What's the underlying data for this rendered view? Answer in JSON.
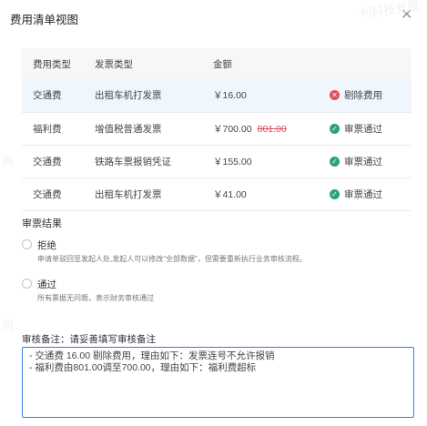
{
  "dialog": {
    "title": "费用清单视图",
    "close_icon": "close-icon"
  },
  "watermark": [
    "利科技有限",
    "司",
    "司"
  ],
  "table": {
    "headers": [
      "费用类型",
      "发票类型",
      "金额",
      ""
    ],
    "rows": [
      {
        "type": "交通费",
        "invoice": "出租车机打发票",
        "amount": "￥16.00",
        "old_amount": "",
        "status": "剔除费用",
        "status_icon": "close-circle-icon",
        "status_color": "#e34d59",
        "highlighted": true
      },
      {
        "type": "福利费",
        "invoice": "增值税普通发票",
        "amount": "￥700.00",
        "old_amount": "801.00",
        "status": "审票通过",
        "status_icon": "check-circle-icon",
        "status_color": "#2ba471",
        "highlighted": false
      },
      {
        "type": "交通费",
        "invoice": "铁路车票报销凭证",
        "amount": "￥155.00",
        "old_amount": "",
        "status": "审票通过",
        "status_icon": "check-circle-icon",
        "status_color": "#2ba471",
        "highlighted": false
      },
      {
        "type": "交通费",
        "invoice": "出租车机打发票",
        "amount": "￥41.00",
        "old_amount": "",
        "status": "审票通过",
        "status_icon": "check-circle-icon",
        "status_color": "#2ba471",
        "highlighted": false
      }
    ]
  },
  "review": {
    "label": "审票结果",
    "options": [
      {
        "label": "拒绝",
        "desc": "申请单驳回至发起人处,发起人可以修改\"全部数据\"，但需要重新执行业务审核流程。"
      },
      {
        "label": "通过",
        "desc": "所有票据无问题，表示财务审核通过"
      }
    ]
  },
  "note": {
    "label": "审核备注：请妥善填写审核备注",
    "value": "- 交通费 16.00 剔除费用，理由如下：发票连号不允许报销\n- 福利费由801.00调至700.00，理由如下：福利费超标"
  }
}
